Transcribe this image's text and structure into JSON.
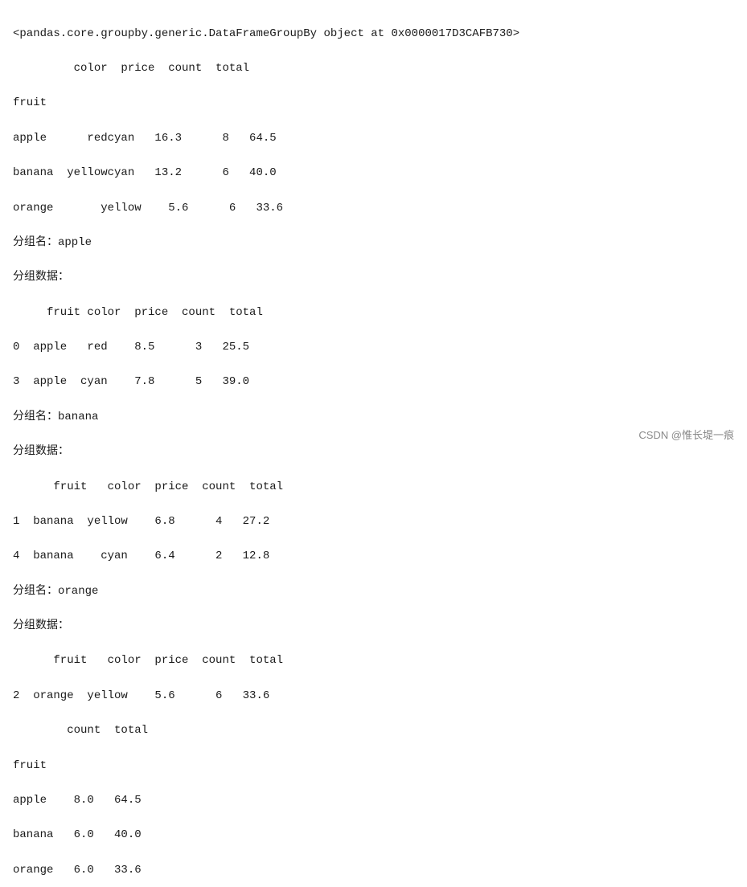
{
  "output": {
    "line1": "<pandas.core.groupby.generic.DataFrameGroupBy object at 0x0000017D3CAFB730>",
    "line2": "         color  price  count  total",
    "line3": "fruit",
    "line4": "apple      redcyan   16.3      8   64.5",
    "line5": "banana  yellowcyan   13.2      6   40.0",
    "line6": "orange       yellow    5.6      6   33.6",
    "line7": "分组名：apple",
    "line8": "分组数据：",
    "line9": "     fruit color  price  count  total",
    "line10": "0  apple   red    8.5      3   25.5",
    "line11": "3  apple  cyan    7.8      5   39.0",
    "line12": "分组名：banana",
    "line13": "分组数据：",
    "line14": "      fruit   color  price  count  total",
    "line15": "1  banana  yellow    6.8      4   27.2",
    "line16": "4  banana    cyan    6.4      2   12.8",
    "line17": "分组名：orange",
    "line18": "分组数据：",
    "line19": "      fruit   color  price  count  total",
    "line20": "2  orange  yellow    5.6      6   33.6",
    "line21": "        count  total",
    "line22": "fruit",
    "line23": "apple    8.0   64.5",
    "line24": "banana   6.0   40.0",
    "line25": "orange   6.0   33.6",
    "watermark": "CSDN @惟长堤一痕"
  }
}
